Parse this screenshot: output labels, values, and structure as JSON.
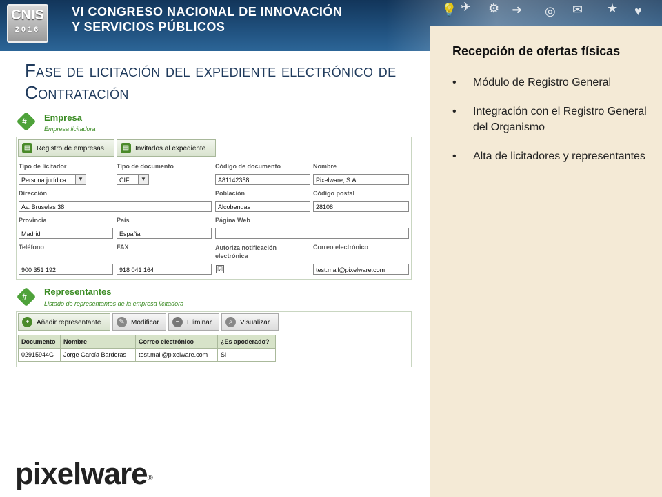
{
  "banner": {
    "logo_text": "CNIS",
    "logo_year": "2016",
    "title_line1": "VI CONGRESO NACIONAL DE INNOVACIÓN",
    "title_line2": "Y SERVICIOS PÚBLICOS"
  },
  "slide_title": "Fase de licitación del expediente electrónico de Contratación",
  "right_panel": {
    "title": "Recepción de ofertas físicas",
    "bullet": "•",
    "items": [
      "Módulo de Registro General",
      "Integración con el Registro General del Organismo",
      "Alta de licitadores y representantes"
    ]
  },
  "empresa": {
    "title": "Empresa",
    "subtitle": "Empresa licitadora",
    "buttons": {
      "registro": "Registro de empresas",
      "invitados": "Invitados al expediente"
    },
    "labels": {
      "tipo_licitador": "Tipo de licitador",
      "tipo_documento": "Tipo de documento",
      "codigo_documento": "Código de documento",
      "nombre": "Nombre",
      "direccion": "Dirección",
      "poblacion": "Población",
      "codigo_postal": "Código postal",
      "provincia": "Provincia",
      "pais": "País",
      "pagina_web": "Página Web",
      "telefono": "Teléfono",
      "fax": "FAX",
      "autoriza": "Autoriza notificación electrónica",
      "correo": "Correo electrónico"
    },
    "values": {
      "tipo_licitador": "Persona jurídica",
      "tipo_documento": "CIF",
      "codigo_documento": "A81142358",
      "nombre": "Pixelware, S.A.",
      "direccion": "Av. Bruselas 38",
      "poblacion": "Alcobendas",
      "codigo_postal": "28108",
      "provincia": "Madrid",
      "pais": "España",
      "pagina_web": "",
      "telefono": "900 351 192",
      "fax": "918 041 164",
      "autoriza": "☑",
      "correo": "test.mail@pixelware.com"
    }
  },
  "representantes": {
    "title": "Representantes",
    "subtitle": "Listado de representantes de la empresa licitadora",
    "buttons": {
      "anadir": "Añadir representante",
      "modificar": "Modificar",
      "eliminar": "Eliminar",
      "visualizar": "Visualizar"
    },
    "columns": [
      "Documento",
      "Nombre",
      "Correo electrónico",
      "¿Es apoderado?"
    ],
    "rows": [
      [
        "02915944G",
        "Jorge García Barderas",
        "test.mail@pixelware.com",
        "Si"
      ]
    ]
  },
  "footer": {
    "logo_text": "pixelware",
    "registered": "®"
  },
  "colors": {
    "banner": "#1f4f7c",
    "panel": "#f4ead6",
    "title": "#1f3a5c",
    "accent_green": "#3a8b23"
  }
}
